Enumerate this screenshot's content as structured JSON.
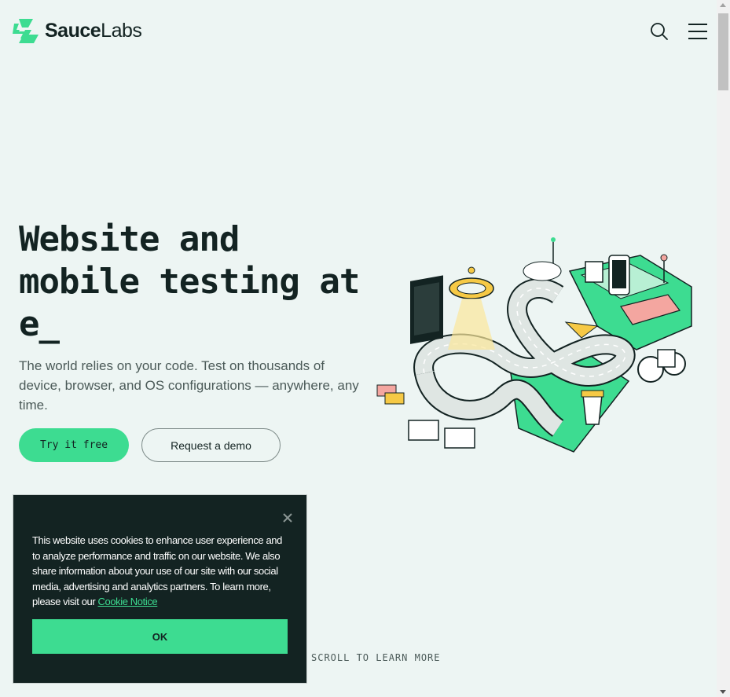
{
  "header": {
    "logo_bold": "Sauce",
    "logo_regular": "Labs",
    "search_icon": "search-icon",
    "menu_icon": "menu-icon"
  },
  "hero": {
    "title": "Website and mobile testing at e_",
    "subtitle": "The world relies on your code. Test on thousands of device, browser, and OS configurations — anywhere, any time.",
    "primary_cta": "Try it free",
    "secondary_cta": "Request a demo"
  },
  "scroll_hint": "SCROLL TO LEARN MORE",
  "cookie_banner": {
    "text": "This website uses cookies to enhance user experience and to analyze performance and traffic on our website. We also share information about your use of our site with our social media, advertising and analytics partners. To learn more, please visit our ",
    "link_text": "Cookie Notice",
    "ok_label": "OK"
  },
  "colors": {
    "brand_green": "#3ddc91",
    "dark": "#132322",
    "background": "#edf5f3"
  }
}
